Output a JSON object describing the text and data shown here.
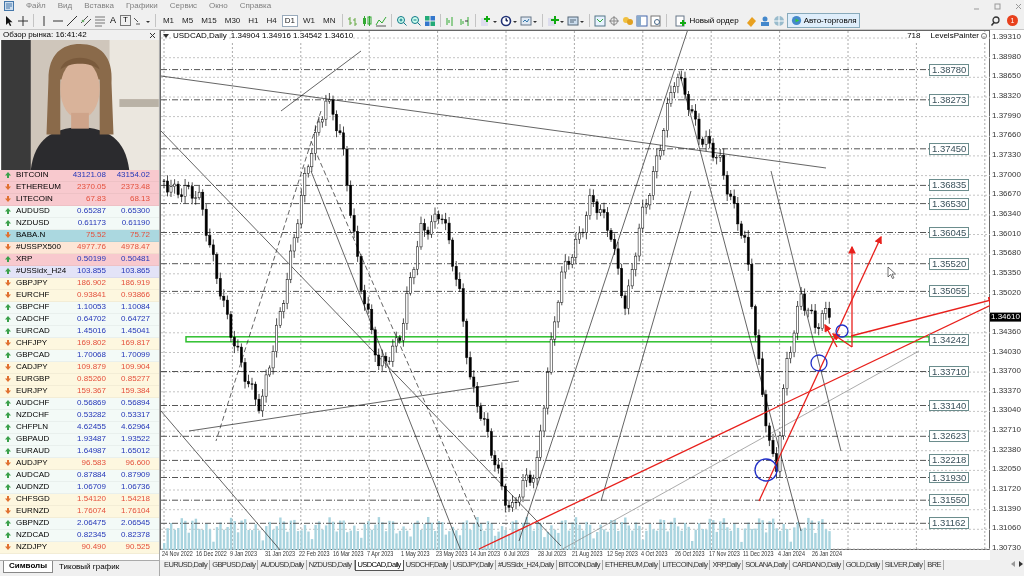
{
  "menu": [
    "Файл",
    "Вид",
    "Вставка",
    "Графики",
    "Сервис",
    "Окно",
    "Справка"
  ],
  "toolbar": {
    "tools_text": [
      "A",
      "T"
    ],
    "timeframes": [
      {
        "label": "M1",
        "selected": false
      },
      {
        "label": "M5",
        "selected": false
      },
      {
        "label": "M15",
        "selected": false
      },
      {
        "label": "M30",
        "selected": false
      },
      {
        "label": "H1",
        "selected": false
      },
      {
        "label": "H4",
        "selected": false
      },
      {
        "label": "D1",
        "selected": true
      },
      {
        "label": "W1",
        "selected": false
      },
      {
        "label": "MN",
        "selected": false
      }
    ],
    "new_order": "Новый ордер",
    "auto_trading": {
      "label": "Авто-торговля",
      "on": true
    },
    "notification_count": "1"
  },
  "market_watch": {
    "title": "Обзор рынка: 16:41:42",
    "rows": [
      {
        "symbol": "BITCOIN",
        "bid": "43121.08",
        "ask": "43154.02",
        "kind": "up",
        "color": "#f8c9ce"
      },
      {
        "symbol": "ETHEREUM",
        "bid": "2370.05",
        "ask": "2373.48",
        "kind": "down",
        "color": "#f8c9ce"
      },
      {
        "symbol": "LITECOIN",
        "bid": "67.83",
        "ask": "68.13",
        "kind": "down",
        "color": "#f8c9ce"
      },
      {
        "symbol": "AUDUSD",
        "bid": "0.65287",
        "ask": "0.65300",
        "kind": "up",
        "color": "#f3faf7"
      },
      {
        "symbol": "NZDUSD",
        "bid": "0.61173",
        "ask": "0.61190",
        "kind": "up",
        "color": "#f3faf7"
      },
      {
        "symbol": "BABA.N",
        "bid": "75.52",
        "ask": "75.72",
        "kind": "down",
        "color": "#abd8e0"
      },
      {
        "symbol": "#USSPX500",
        "bid": "4977.76",
        "ask": "4978.47",
        "kind": "down",
        "color": "#fde6d6"
      },
      {
        "symbol": "XRP",
        "bid": "0.50199",
        "ask": "0.50481",
        "kind": "up",
        "color": "#f8c9ce"
      },
      {
        "symbol": "#USSidx_H24",
        "bid": "103.855",
        "ask": "103.865",
        "kind": "up",
        "color": "#e3e3f7"
      },
      {
        "symbol": "GBPJPY",
        "bid": "186.902",
        "ask": "186.919",
        "kind": "down",
        "color": "#fdf7df"
      },
      {
        "symbol": "EURCHF",
        "bid": "0.93841",
        "ask": "0.93866",
        "kind": "down",
        "color": "#fdf7df"
      },
      {
        "symbol": "GBPCHF",
        "bid": "1.10053",
        "ask": "1.10084",
        "kind": "up",
        "color": "#f3faf7"
      },
      {
        "symbol": "CADCHF",
        "bid": "0.64702",
        "ask": "0.64727",
        "kind": "up",
        "color": "#f3faf7"
      },
      {
        "symbol": "EURCAD",
        "bid": "1.45016",
        "ask": "1.45041",
        "kind": "up",
        "color": "#f3faf7"
      },
      {
        "symbol": "CHFJPY",
        "bid": "169.802",
        "ask": "169.817",
        "kind": "down",
        "color": "#fdf7df"
      },
      {
        "symbol": "GBPCAD",
        "bid": "1.70068",
        "ask": "1.70099",
        "kind": "up",
        "color": "#f3faf7"
      },
      {
        "symbol": "CADJPY",
        "bid": "109.879",
        "ask": "109.904",
        "kind": "down",
        "color": "#fdf7df"
      },
      {
        "symbol": "EURGBP",
        "bid": "0.85260",
        "ask": "0.85277",
        "kind": "down",
        "color": "#fdf7df"
      },
      {
        "symbol": "EURJPY",
        "bid": "159.367",
        "ask": "159.384",
        "kind": "down",
        "color": "#fdf7df"
      },
      {
        "symbol": "AUDCHF",
        "bid": "0.56869",
        "ask": "0.56894",
        "kind": "up",
        "color": "#f3faf7"
      },
      {
        "symbol": "NZDCHF",
        "bid": "0.53282",
        "ask": "0.53317",
        "kind": "up",
        "color": "#f3faf7"
      },
      {
        "symbol": "CHFPLN",
        "bid": "4.62455",
        "ask": "4.62964",
        "kind": "up",
        "color": "#f3faf7"
      },
      {
        "symbol": "GBPAUD",
        "bid": "1.93487",
        "ask": "1.93522",
        "kind": "up",
        "color": "#f3faf7"
      },
      {
        "symbol": "EURAUD",
        "bid": "1.64987",
        "ask": "1.65012",
        "kind": "up",
        "color": "#f3faf7"
      },
      {
        "symbol": "AUDJPY",
        "bid": "96.583",
        "ask": "96.600",
        "kind": "down",
        "color": "#fdf7df"
      },
      {
        "symbol": "AUDCAD",
        "bid": "0.87884",
        "ask": "0.87909",
        "kind": "up",
        "color": "#f3faf7"
      },
      {
        "symbol": "AUDNZD",
        "bid": "1.06709",
        "ask": "1.06736",
        "kind": "up",
        "color": "#f3faf7"
      },
      {
        "symbol": "CHFSGD",
        "bid": "1.54120",
        "ask": "1.54218",
        "kind": "down",
        "color": "#fdf7df"
      },
      {
        "symbol": "EURNZD",
        "bid": "1.76074",
        "ask": "1.76104",
        "kind": "down",
        "color": "#fdf7df"
      },
      {
        "symbol": "GBPNZD",
        "bid": "2.06475",
        "ask": "2.06545",
        "kind": "up",
        "color": "#f3faf7"
      },
      {
        "symbol": "NZDCAD",
        "bid": "0.82345",
        "ask": "0.82378",
        "kind": "up",
        "color": "#f3faf7"
      },
      {
        "symbol": "NZDJPY",
        "bid": "90.490",
        "ask": "90.525",
        "kind": "down",
        "color": "#fdf7df"
      }
    ],
    "tabs": [
      {
        "label": "Символы",
        "selected": true
      },
      {
        "label": "Тиковый график",
        "selected": false
      }
    ]
  },
  "chart": {
    "symbol": "USDCAD,Daily",
    "ohlc": "1.34904 1.34916 1.34542 1.34610",
    "bar_count": "718",
    "indicator": "LevelsPainter",
    "price_axis": [
      "1.39310",
      "1.38980",
      "1.38650",
      "1.38320",
      "1.37990",
      "1.37660",
      "1.37330",
      "1.37000",
      "1.36670",
      "1.36340",
      "1.36010",
      "1.35680",
      "1.35350",
      "1.35020",
      "1.34360",
      "1.34030",
      "1.33700",
      "1.33370",
      "1.33040",
      "1.32710",
      "1.32380",
      "1.32050",
      "1.31720",
      "1.31390",
      "1.31060",
      "1.30730"
    ],
    "current_price": "1.34610",
    "levels": [
      {
        "price": "1.38780",
        "highlighted": false
      },
      {
        "price": "1.38273",
        "highlighted": false
      },
      {
        "price": "1.37450",
        "highlighted": false
      },
      {
        "price": "1.36835",
        "highlighted": false
      },
      {
        "price": "1.36530",
        "highlighted": false
      },
      {
        "price": "1.36045",
        "highlighted": false
      },
      {
        "price": "1.35520",
        "highlighted": false
      },
      {
        "price": "1.35055",
        "highlighted": false
      },
      {
        "price": "1.34242",
        "highlighted": true
      },
      {
        "price": "1.33710",
        "highlighted": false
      },
      {
        "price": "1.33140",
        "highlighted": false
      },
      {
        "price": "1.32623",
        "highlighted": false
      },
      {
        "price": "1.32218",
        "highlighted": false
      },
      {
        "price": "1.31930",
        "highlighted": false
      },
      {
        "price": "1.31550",
        "highlighted": false
      },
      {
        "price": "1.31162",
        "highlighted": false
      }
    ],
    "date_axis": [
      "24 Nov 2022",
      "16 Dec 2022",
      "9 Jan 2023",
      "31 Jan 2023",
      "22 Feb 2023",
      "16 Mar 2023",
      "7 Apr 2023",
      "1 May 2023",
      "23 May 2023",
      "14 Jun 2023",
      "6 Jul 2023",
      "28 Jul 2023",
      "21 Aug 2023",
      "12 Sep 2023",
      "4 Oct 2023",
      "26 Oct 2023",
      "17 Nov 2023",
      "11 Dec 2023",
      "4 Jan 2024",
      "26 Jan 2024"
    ]
  },
  "chart_tabs": [
    {
      "label": "EURUSD,Daily",
      "selected": false
    },
    {
      "label": "GBPUSD,Daily",
      "selected": false
    },
    {
      "label": "AUDUSD,Daily",
      "selected": false
    },
    {
      "label": "NZDUSD,Daily",
      "selected": false
    },
    {
      "label": "USDCAD,Daily",
      "selected": true
    },
    {
      "label": "USDCHF,Daily",
      "selected": false
    },
    {
      "label": "USDJPY,Daily",
      "selected": false
    },
    {
      "label": "#USSidx_H24,Daily",
      "selected": false
    },
    {
      "label": "BITCOIN,Daily",
      "selected": false
    },
    {
      "label": "ETHEREUM,Daily",
      "selected": false
    },
    {
      "label": "LITECOIN,Daily",
      "selected": false
    },
    {
      "label": "XRP,Daily",
      "selected": false
    },
    {
      "label": "SOLANA,Daily",
      "selected": false
    },
    {
      "label": "CARDANO,Daily",
      "selected": false
    },
    {
      "label": "GOLD,Daily",
      "selected": false
    },
    {
      "label": "SILVER,Daily",
      "selected": false
    },
    {
      "label": "BRE",
      "selected": false
    }
  ]
}
